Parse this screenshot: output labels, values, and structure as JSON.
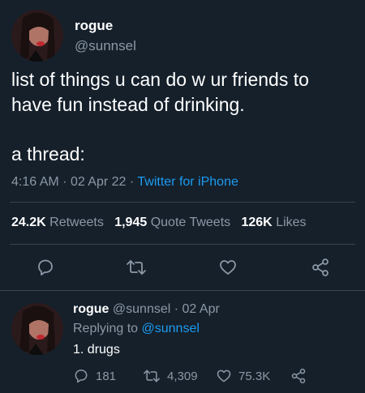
{
  "tweet": {
    "name": "rogue",
    "handle": "@sunnsel",
    "text_line1": "list of things u can do w ur friends to",
    "text_line2": "have fun instead of drinking.",
    "text_line3": "a thread:",
    "time": "4:16 AM",
    "dot1": "·",
    "date": "02 Apr 22",
    "dot2": "·",
    "source": "Twitter for iPhone",
    "stats": {
      "retweets_count": "24.2K",
      "retweets_label": "Retweets",
      "quotes_count": "1,945",
      "quotes_label": "Quote Tweets",
      "likes_count": "126K",
      "likes_label": "Likes"
    }
  },
  "reply": {
    "name": "rogue",
    "handle": "@sunnsel",
    "dot": "·",
    "date": "02 Apr",
    "replying_prefix": "Replying to",
    "replying_handle": "@sunnsel",
    "text": "1. drugs",
    "replies": "181",
    "retweets": "4,309",
    "likes": "75.3K"
  },
  "colors": {
    "background": "#15202b",
    "text": "#ffffff",
    "muted": "#8b98a5",
    "link": "#1d9bf0",
    "divider": "#38444d"
  },
  "icons": [
    "reply-icon",
    "retweet-icon",
    "like-icon",
    "share-icon"
  ]
}
